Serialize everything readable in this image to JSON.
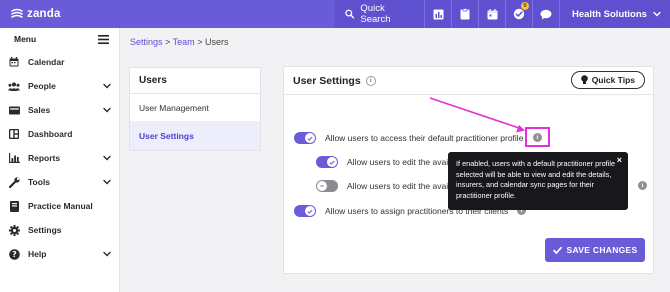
{
  "brand": {
    "name": "zanda"
  },
  "topbar": {
    "search_label": "Quick Search",
    "icons": [
      "bar-chart-icon",
      "clipboard-icon",
      "calendar-icon",
      "tasks-icon",
      "chat-icon"
    ],
    "tasks_badge": "0",
    "org_name": "Health Solutions"
  },
  "sidebar": {
    "menu_label": "Menu",
    "items": [
      {
        "label": "Calendar",
        "icon": "calendar-icon",
        "has_chevron": false
      },
      {
        "label": "People",
        "icon": "people-icon",
        "has_chevron": true
      },
      {
        "label": "Sales",
        "icon": "wallet-icon",
        "has_chevron": true
      },
      {
        "label": "Dashboard",
        "icon": "dashboard-icon",
        "has_chevron": false
      },
      {
        "label": "Reports",
        "icon": "chart-icon",
        "has_chevron": true
      },
      {
        "label": "Tools",
        "icon": "wrench-icon",
        "has_chevron": true
      },
      {
        "label": "Practice Manual",
        "icon": "book-icon",
        "has_chevron": false
      },
      {
        "label": "Settings",
        "icon": "gear-icon",
        "has_chevron": false
      },
      {
        "label": "Help",
        "icon": "help-icon",
        "has_chevron": true
      }
    ]
  },
  "breadcrumb": {
    "settings": "Settings",
    "sep1": ">",
    "team": "Team",
    "sep2": ">",
    "current": "Users"
  },
  "users_panel": {
    "title": "Users",
    "items": [
      {
        "label": "User Management",
        "active": false
      },
      {
        "label": "User Settings",
        "active": true
      }
    ]
  },
  "user_settings": {
    "title": "User Settings",
    "quick_tips": "Quick Tips",
    "settings": [
      {
        "label": "Allow users to access their default practitioner profile",
        "enabled": true
      },
      {
        "label": "Allow users to edit the avail",
        "enabled": true
      },
      {
        "label": "Allow users to edit the avail",
        "enabled": false
      },
      {
        "label": "Allow users to assign practitioners to their clients",
        "enabled": true
      }
    ],
    "save_label": "SAVE CHANGES"
  },
  "tooltip": {
    "text": "If enabled, users with a default practitioner profile selected will be able to view and edit the details, insurers, and calendar sync pages for their practitioner profile.",
    "close": "×"
  },
  "colors": {
    "accent": "#6a5cd8",
    "highlight": "#e62fd6"
  }
}
